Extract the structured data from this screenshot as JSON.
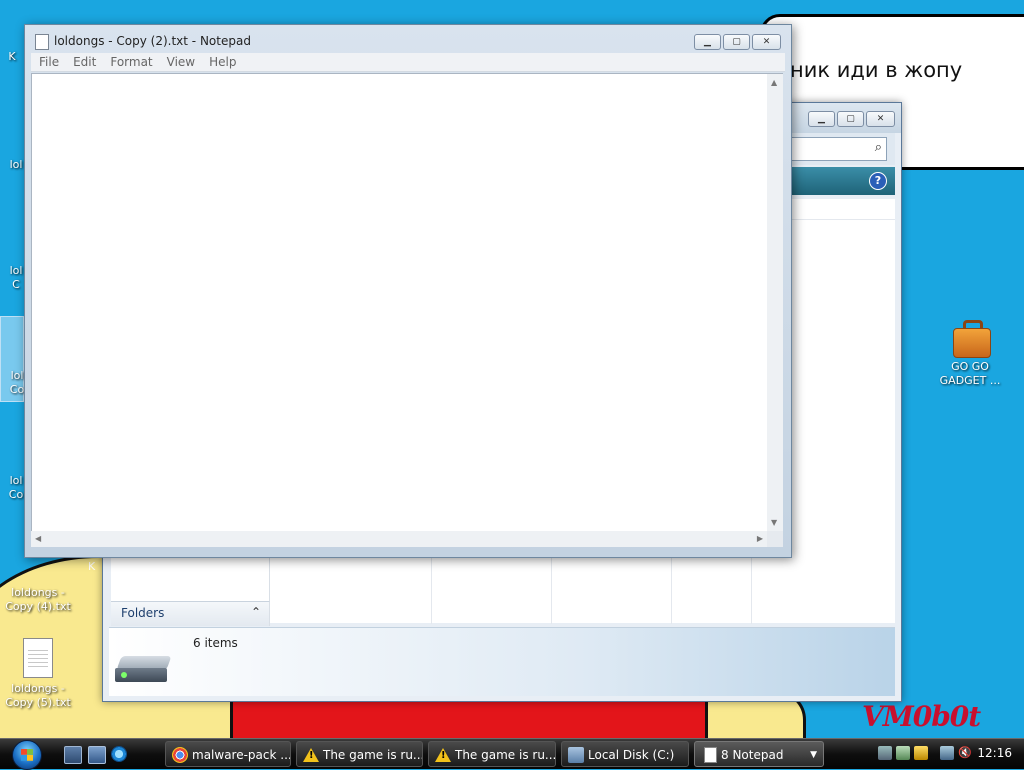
{
  "desktop": {
    "bubble_text": "ник иди в жопу",
    "watermark": "VM0b0t",
    "icons": [
      {
        "label_line1": "loldongs -",
        "label_line2": "Copy (4).txt"
      },
      {
        "label_line1": "loldongs -",
        "label_line2": "Copy (5).txt"
      },
      {
        "label_line1": "GO GO",
        "label_line2": "GADGET ..."
      }
    ],
    "partial_labels": [
      "K",
      "lol",
      "lol",
      "C",
      "lol",
      "Co",
      "lol",
      "Co",
      "K"
    ]
  },
  "notepad": {
    "title": "loldongs - Copy (2).txt - Notepad",
    "menu": [
      "File",
      "Edit",
      "Format",
      "View",
      "Help"
    ],
    "content": ""
  },
  "explorer": {
    "folders_label": "Folders",
    "item_count": "6 items"
  },
  "taskbar": {
    "tasks": [
      {
        "label": "malware-pack ...",
        "icon": "chrome-icon"
      },
      {
        "label": "The game is ru...",
        "icon": "warning-icon"
      },
      {
        "label": "The game is ru...",
        "icon": "warning-icon"
      },
      {
        "label": "Local Disk (C:)",
        "icon": "folder-icon"
      },
      {
        "label": "8 Notepad",
        "icon": "notepad-icon"
      }
    ],
    "clock": "12:16"
  }
}
